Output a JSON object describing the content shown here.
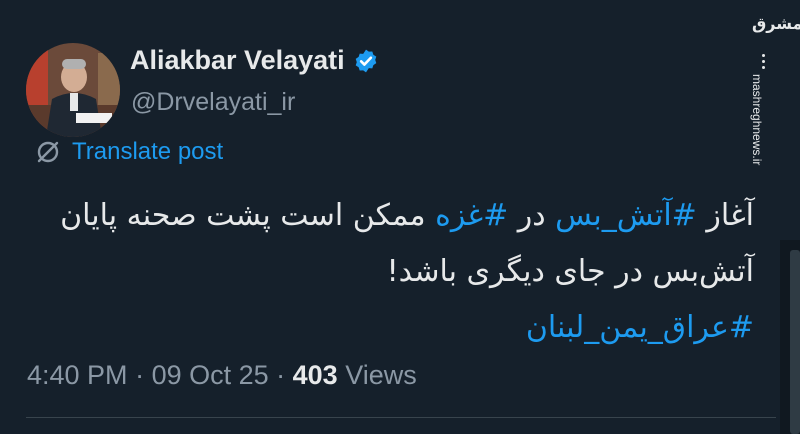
{
  "author": {
    "name": "Aliakbar Velayati",
    "handle": "@Drvelayati_ir",
    "verified": true
  },
  "translate": {
    "label": "Translate post",
    "icon": "translate-globe-icon"
  },
  "tweet": {
    "line1": [
      {
        "text": "آغاز ",
        "hashtag": false
      },
      {
        "text": "#آتش_بس",
        "hashtag": true
      },
      {
        "text": " در ",
        "hashtag": false
      },
      {
        "text": "#غزه",
        "hashtag": true
      },
      {
        "text": " ممکن است پشت صحنه پایان",
        "hashtag": false
      }
    ],
    "line2": "آتش‌بس در جای دیگری باشد!",
    "line3": "#عراق_یمن_لبنان"
  },
  "meta": {
    "time": "4:40 PM",
    "sep1": " · ",
    "date": "09 Oct 25",
    "sep2": " · ",
    "views_count": "403",
    "views_label": " Views"
  },
  "watermark": {
    "logo": "مشرق",
    "site": "mashreghnews.ir"
  },
  "colors": {
    "background": "#15202b",
    "accent": "#1d9bf0",
    "text": "#e7e9ea",
    "muted": "#8b98a5"
  }
}
